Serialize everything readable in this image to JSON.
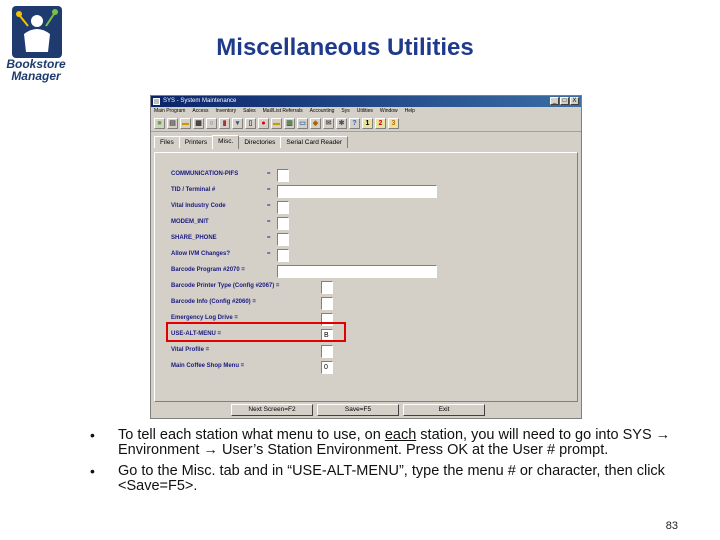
{
  "slide": {
    "title": "Miscellaneous Utilities",
    "logo_line1": "Bookstore",
    "logo_line2": "Manager",
    "page_number": "83",
    "bullet1_a": "To tell each station what menu to use, on ",
    "bullet1_u": "each",
    "bullet1_b": " station, you will need to go into SYS → Environment → User’s Station Environment.  Press OK at the User # prompt.",
    "bullet2": "Go to the Misc. tab and in “USE-ALT-MENU”, type the menu # or character, then click <Save=F5>."
  },
  "window": {
    "title": "SYS - System Maintenance",
    "menu": [
      "Main Program",
      "Access",
      "Inventory",
      "Sales",
      "Mail/List Referrals",
      "Accounting",
      "Sys",
      "Utilities",
      "Window",
      "Help"
    ],
    "toolbar_numbers": [
      "1",
      "2",
      "3"
    ],
    "tabs": [
      "Files",
      "Printers",
      "Misc.",
      "Directories",
      "Serial Card Reader"
    ],
    "active_tab": "Misc.",
    "fields": [
      {
        "label": "COMMUNICATION-PIFS",
        "eq": "=",
        "value": ""
      },
      {
        "label": "TID / Terminal #",
        "eq": "=",
        "value": ""
      },
      {
        "label": "Vital Industry Code",
        "eq": "=",
        "value": ""
      },
      {
        "label": "MODEM_INIT",
        "eq": "=",
        "value": ""
      },
      {
        "label": "SHARE_PHONE",
        "eq": "=",
        "value": ""
      },
      {
        "label": "Allow IVM Changes?",
        "eq": "=",
        "value": ""
      },
      {
        "label": "Barcode Program #2070 =",
        "eq": "",
        "value": ""
      },
      {
        "label": "Barcode Printer Type (Config #2067) =",
        "eq": "",
        "value": ""
      },
      {
        "label": "Barcode Info (Config #2060) =",
        "eq": "",
        "value": ""
      },
      {
        "label": "Emergency Log Drive =",
        "eq": "",
        "value": ""
      },
      {
        "label": "USE-ALT-MENU =",
        "eq": "",
        "value": "B"
      },
      {
        "label": "Vital Profile =",
        "eq": "",
        "value": ""
      },
      {
        "label": "Main Coffee Shop Menu =",
        "eq": "",
        "value": "0"
      }
    ],
    "buttons": {
      "next": "Next Screen=F2",
      "save": "Save=F5",
      "exit": "Exit"
    },
    "close_glyph": "X",
    "min_glyph": "_",
    "max_glyph": "□"
  }
}
